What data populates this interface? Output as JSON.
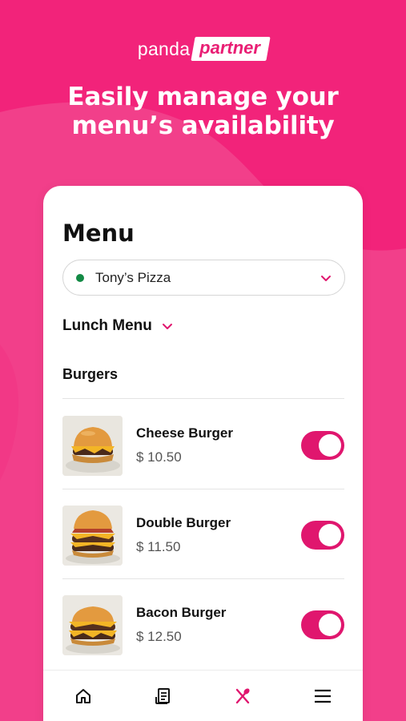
{
  "brand": {
    "name_part1": "panda",
    "name_part2": "partner",
    "primary_color": "#f2237a",
    "accent_color": "#e0166e"
  },
  "headline": "Easily manage your menu’s availability",
  "screen": {
    "title": "Menu",
    "restaurant_select": {
      "value": "Tony’s Pizza",
      "status_color": "#138a45",
      "icon": "chevron-down-icon"
    },
    "menu_switch": {
      "label": "Lunch Menu",
      "icon": "chevron-down-icon"
    },
    "category": "Burgers",
    "items": [
      {
        "name": "Cheese Burger",
        "price": "$ 10.50",
        "available": true
      },
      {
        "name": "Double Burger",
        "price": "$ 11.50",
        "available": true
      },
      {
        "name": "Bacon Burger",
        "price": "$ 12.50",
        "available": true
      }
    ]
  },
  "bottom_nav": [
    {
      "icon": "home-icon",
      "active": false
    },
    {
      "icon": "orders-receipt-icon",
      "active": false
    },
    {
      "icon": "menu-utensils-icon",
      "active": true
    },
    {
      "icon": "hamburger-menu-icon",
      "active": false
    }
  ]
}
